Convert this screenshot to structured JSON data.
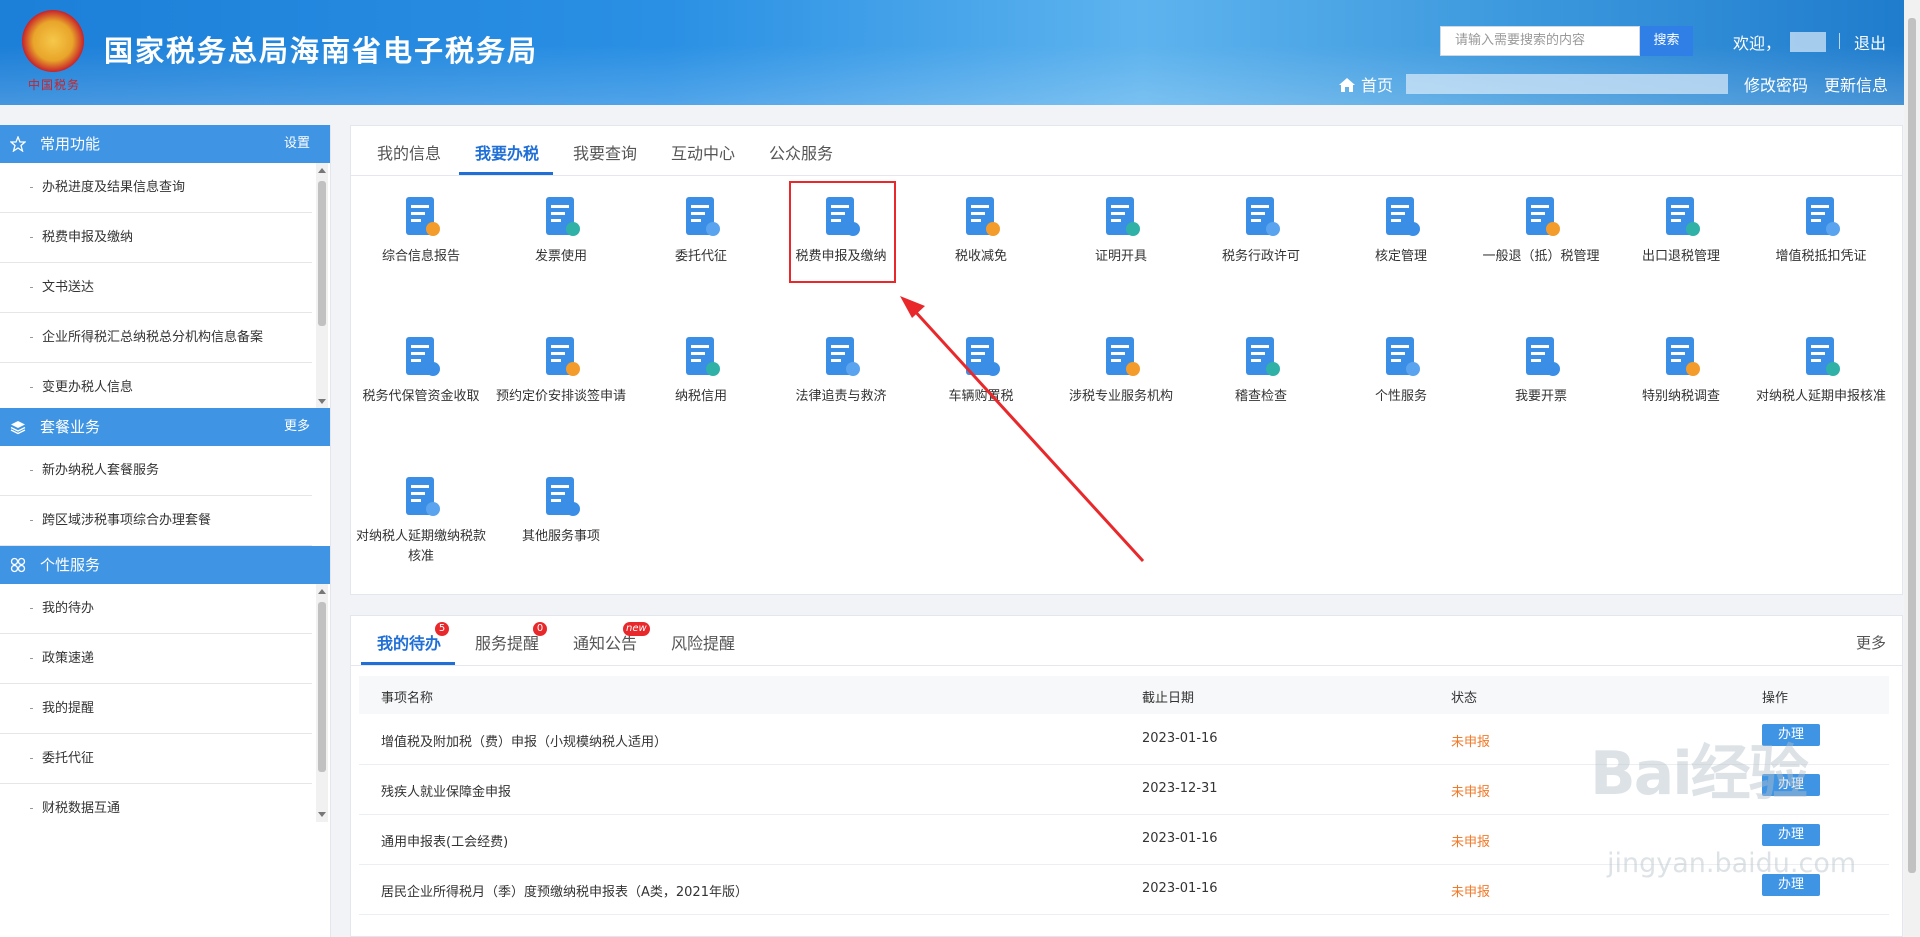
{
  "header": {
    "title": "国家税务总局海南省电子税务局",
    "emblem_text": "中国税务",
    "search_placeholder": "请输入需要搜索的内容",
    "search_button": "搜索",
    "welcome": "欢迎，",
    "logout": "退出",
    "home": "首页",
    "change_password": "修改密码",
    "update_info": "更新信息"
  },
  "sidebar": {
    "common": {
      "title": "常用功能",
      "action": "设置",
      "items": [
        "办税进度及结果信息查询",
        "税费申报及缴纳",
        "文书送达",
        "企业所得税汇总纳税总分机构信息备案",
        "变更办税人信息"
      ]
    },
    "package": {
      "title": "套餐业务",
      "action": "更多",
      "items": [
        "新办纳税人套餐服务",
        "跨区域涉税事项综合办理套餐"
      ]
    },
    "personal": {
      "title": "个性服务",
      "items": [
        "我的待办",
        "政策速递",
        "我的提醒",
        "委托代征",
        "财税数据互通"
      ]
    }
  },
  "main": {
    "tabs": [
      "我的信息",
      "我要办税",
      "我要查询",
      "互动中心",
      "公众服务"
    ],
    "active_tab": "我要办税",
    "services": [
      {
        "label": "综合信息报告",
        "icon": "report-icon"
      },
      {
        "label": "发票使用",
        "icon": "printer-icon"
      },
      {
        "label": "委托代征",
        "icon": "card-icon"
      },
      {
        "label": "税费申报及缴纳",
        "icon": "declare-icon"
      },
      {
        "label": "税收减免",
        "icon": "reduce-icon"
      },
      {
        "label": "证明开具",
        "icon": "certificate-icon"
      },
      {
        "label": "税务行政许可",
        "icon": "binder-icon"
      },
      {
        "label": "核定管理",
        "icon": "clipboard-icon"
      },
      {
        "label": "一般退（抵）税管理",
        "icon": "refund-icon"
      },
      {
        "label": "出口退税管理",
        "icon": "ship-icon"
      },
      {
        "label": "增值税抵扣凭证",
        "icon": "voucher-icon"
      },
      {
        "label": "税务代保管资金收取",
        "icon": "hand-coin-icon"
      },
      {
        "label": "预约定价安排谈签申请",
        "icon": "calendar-icon"
      },
      {
        "label": "纳税信用",
        "icon": "shield-icon"
      },
      {
        "label": "法律追责与救济",
        "icon": "law-icon"
      },
      {
        "label": "车辆购置税",
        "icon": "car-tax-icon"
      },
      {
        "label": "涉税专业服务机构",
        "icon": "heart-hand-icon"
      },
      {
        "label": "稽查检查",
        "icon": "monitor-chart-icon"
      },
      {
        "label": "个性服务",
        "icon": "hand-doc-icon"
      },
      {
        "label": "我要开票",
        "icon": "invoice-screen-icon"
      },
      {
        "label": "特别纳税调查",
        "icon": "search-doc-icon"
      },
      {
        "label": "对纳税人延期申报核准",
        "icon": "books-search-icon"
      },
      {
        "label": "对纳税人延期缴纳税款核准",
        "icon": "calendar-clock-icon"
      },
      {
        "label": "其他服务事项",
        "icon": "layers-icon"
      }
    ]
  },
  "todo": {
    "tabs": [
      {
        "label": "我的待办",
        "badge": "5"
      },
      {
        "label": "服务提醒",
        "badge": "0"
      },
      {
        "label": "通知公告",
        "badge": "new"
      },
      {
        "label": "风险提醒",
        "badge": ""
      }
    ],
    "more": "更多",
    "columns": [
      "事项名称",
      "截止日期",
      "状态",
      "操作"
    ],
    "rows": [
      {
        "name": "增值税及附加税（费）申报（小规模纳税人适用）",
        "date": "2023-01-16",
        "status": "未申报",
        "action": "办理"
      },
      {
        "name": "残疾人就业保障金申报",
        "date": "2023-12-31",
        "status": "未申报",
        "action": "办理"
      },
      {
        "name": "通用申报表(工会经费)",
        "date": "2023-01-16",
        "status": "未申报",
        "action": "办理"
      },
      {
        "name": "居民企业所得税月（季）度预缴纳税申报表（A类，2021年版）",
        "date": "2023-01-16",
        "status": "未申报",
        "action": "办理"
      }
    ]
  },
  "watermark": {
    "brand": "Bai经验",
    "url": "jingyan.baidu.com"
  },
  "colors": {
    "accent": "#1f6fd6",
    "sidebar_head": "#3f94e4",
    "status": "#f07a2a",
    "highlight": "#e8282b"
  }
}
